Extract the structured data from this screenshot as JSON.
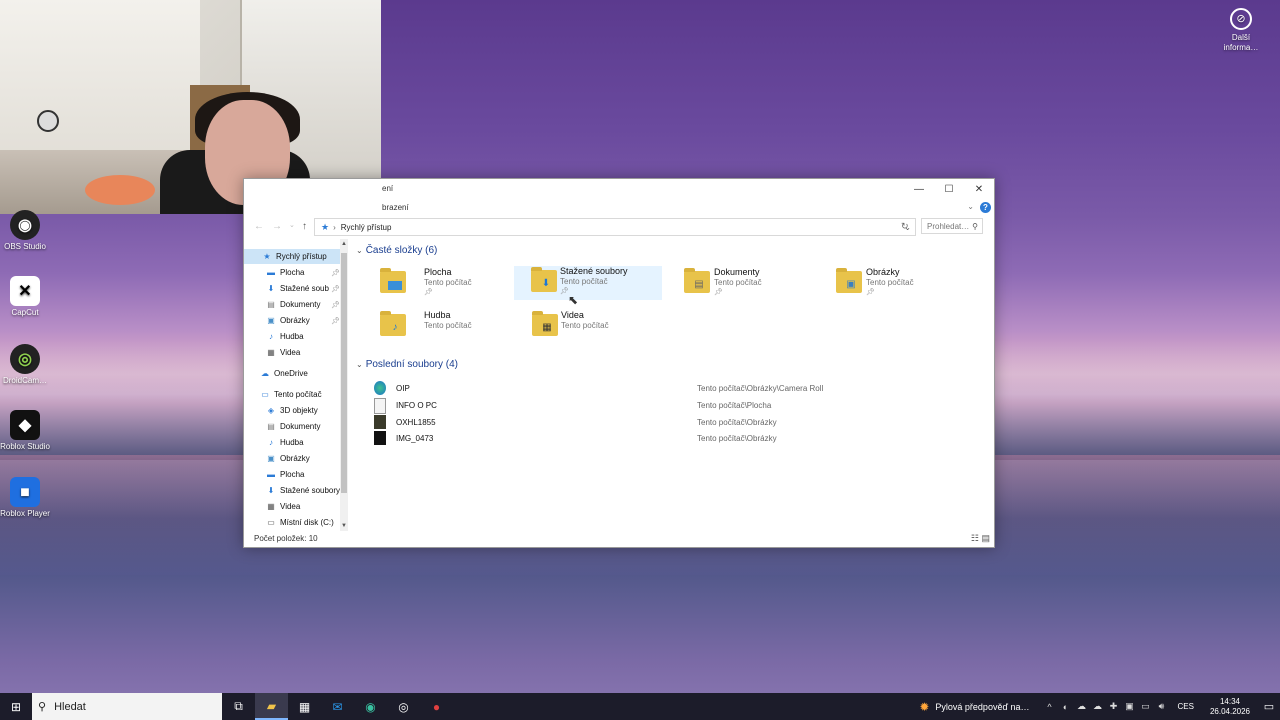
{
  "desktop": {
    "top_right_item": "Další informa…",
    "icons": [
      {
        "label": "OBS Studio",
        "icon": "obs-icon"
      },
      {
        "label": "CapCut",
        "icon": "capcut-icon"
      },
      {
        "label": "DroidCam…",
        "icon": "droidcam-icon"
      },
      {
        "label": "Roblox Studio",
        "icon": "roblox-studio-icon"
      },
      {
        "label": "Roblox Player",
        "icon": "roblox-player-icon"
      }
    ]
  },
  "explorer": {
    "title": "ení",
    "ribbon_tab": "brazení",
    "address_path": "Rychlý přístup",
    "search_placeholder": "Prohledat…",
    "status": "Počet položek: 10",
    "nav": {
      "quick_access": "Rychlý přístup",
      "quick_items": [
        "Plocha",
        "Stažené soub",
        "Dokumenty",
        "Obrázky",
        "Hudba",
        "Videa"
      ],
      "onedrive": "OneDrive",
      "this_pc": "Tento počítač",
      "pc_items": [
        "3D objekty",
        "Dokumenty",
        "Hudba",
        "Obrázky",
        "Plocha",
        "Stažené soubory",
        "Videa",
        "Místní disk (C:)"
      ]
    },
    "frequent": {
      "header": "Časté složky (6)",
      "folders": [
        {
          "name": "Plocha",
          "sub": "Tento počítač"
        },
        {
          "name": "Stažené soubory",
          "sub": "Tento počítač"
        },
        {
          "name": "Dokumenty",
          "sub": "Tento počítač"
        },
        {
          "name": "Obrázky",
          "sub": "Tento počítač"
        },
        {
          "name": "Hudba",
          "sub": "Tento počítač"
        },
        {
          "name": "Videa",
          "sub": "Tento počítač"
        }
      ]
    },
    "recent": {
      "header": "Poslední soubory (4)",
      "files": [
        {
          "name": "OIP",
          "path": "Tento počítač\\Obrázky\\Camera Roll"
        },
        {
          "name": "INFO O PC",
          "path": "Tento počítač\\Plocha"
        },
        {
          "name": "OXHL1855",
          "path": "Tento počítač\\Obrázky"
        },
        {
          "name": "IMG_0473",
          "path": "Tento počítač\\Obrázky"
        }
      ]
    }
  },
  "taskbar": {
    "search_placeholder": "Hledat",
    "weather": "Pylová předpověď na…",
    "language": "CES",
    "time": "14:34",
    "date": "26.04.2026"
  }
}
